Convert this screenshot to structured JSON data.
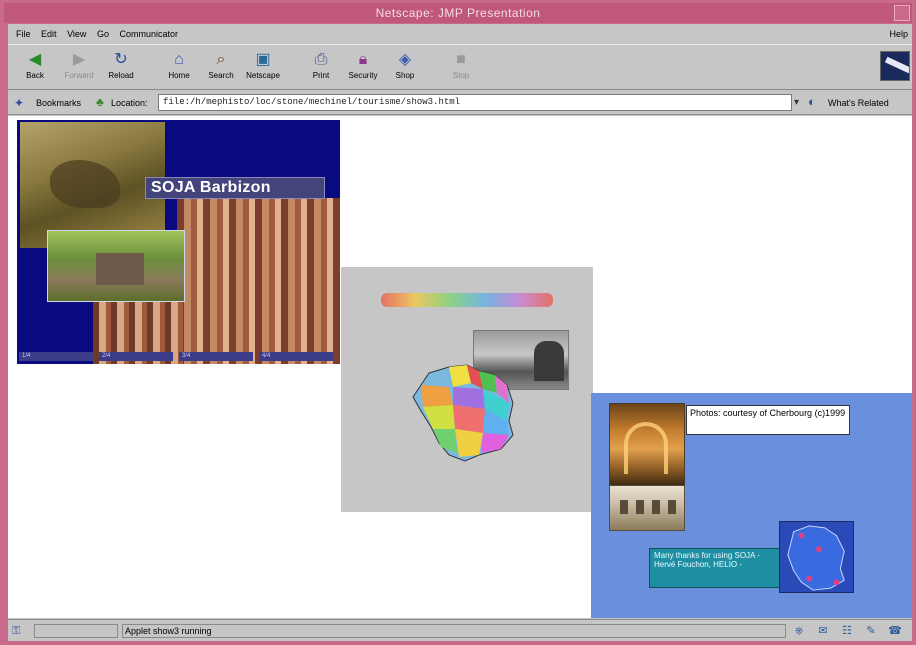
{
  "window": {
    "title": "Netscape: JMP Presentation"
  },
  "menubar": {
    "items": [
      "File",
      "Edit",
      "View",
      "Go",
      "Communicator"
    ],
    "help": "Help"
  },
  "toolbar": {
    "buttons": [
      {
        "label": "Back",
        "icon": "back-arrow-icon",
        "enabled": true
      },
      {
        "label": "Forward",
        "icon": "forward-arrow-icon",
        "enabled": false
      },
      {
        "label": "Reload",
        "icon": "reload-icon",
        "enabled": true
      },
      {
        "label": "Home",
        "icon": "home-icon",
        "enabled": true
      },
      {
        "label": "Search",
        "icon": "search-icon",
        "enabled": true
      },
      {
        "label": "Netscape",
        "icon": "netscape-icon",
        "enabled": true
      },
      {
        "label": "Print",
        "icon": "print-icon",
        "enabled": true
      },
      {
        "label": "Security",
        "icon": "security-lock-icon",
        "enabled": true
      },
      {
        "label": "Shop",
        "icon": "shop-bag-icon",
        "enabled": true
      },
      {
        "label": "Stop",
        "icon": "stop-icon",
        "enabled": false
      }
    ]
  },
  "location": {
    "bookmarks_label": "Bookmarks",
    "location_label": "Location:",
    "url": "file:/h/mephisto/loc/stone/mechinel/tourisme/show3.html",
    "related_label": "What's Related"
  },
  "slides": {
    "slide1": {
      "title": "SOJA Barbizon",
      "thumbs": [
        "1/4",
        "2/4",
        "3/4",
        "4/4"
      ]
    },
    "slide3": {
      "credit": "Photos: courtesy of Cherbourg (c)1999",
      "thanks": "Many thanks for using SOJA - Hervé Fouchon, HELIO -"
    }
  },
  "status": {
    "text": "Applet show3 running"
  },
  "colors": {
    "titlebar": "#c0577d",
    "chrome": "#c6c6c6",
    "slide1_bg": "#0a0a80",
    "slide3_bg": "#6a8fdc"
  }
}
